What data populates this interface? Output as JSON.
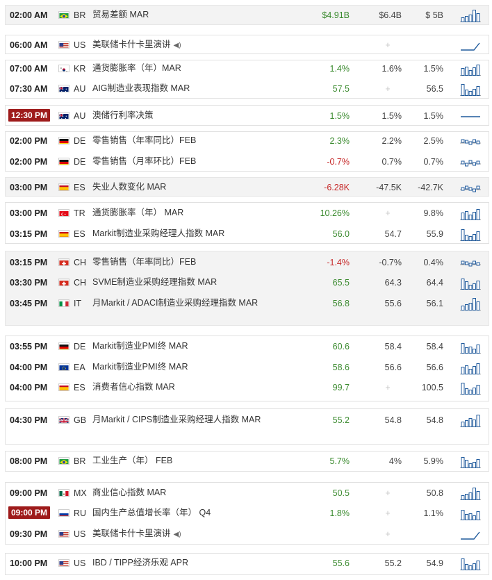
{
  "colors": {
    "positive": "#3a8a2e",
    "negative": "#c62828",
    "badge": "#9e1b1b",
    "chart": "#1f5a9c"
  },
  "events": [
    {
      "time": "02:00 AM",
      "badge": false,
      "flag": "br",
      "country": "BR",
      "event": "贸易差额 MAR",
      "actual": "$4.91B",
      "actual_class": "pos",
      "forecast": "$6.4B",
      "previous": "$ 5B",
      "chart": "bars"
    },
    {
      "time": "06:00 AM",
      "badge": false,
      "flag": "us",
      "country": "US",
      "event": "美联储卡什卡里演讲",
      "speaker": true,
      "actual": "",
      "forecast": "+",
      "previous": "",
      "chart": "speech"
    },
    {
      "time": "07:00 AM",
      "badge": false,
      "flag": "kr",
      "country": "KR",
      "event": "通货膨胀率（年）MAR",
      "actual": "1.4%",
      "actual_class": "pos",
      "forecast": "1.6%",
      "previous": "1.5%",
      "chart": "bars"
    },
    {
      "time": "07:30 AM",
      "badge": false,
      "flag": "au",
      "country": "AU",
      "event": "AIG制造业表现指数 MAR",
      "actual": "57.5",
      "actual_class": "pos",
      "forecast": "+",
      "previous": "56.5",
      "chart": "bars"
    },
    {
      "time": "12:30 PM",
      "badge": true,
      "flag": "au",
      "country": "AU",
      "event": "澳储行利率决策",
      "actual": "1.5%",
      "actual_class": "pos",
      "forecast": "1.5%",
      "previous": "1.5%",
      "chart": "flat"
    },
    {
      "time": "02:00 PM",
      "badge": false,
      "flag": "de",
      "country": "DE",
      "event": "零售销售（年率同比）FEB",
      "actual": "2.3%",
      "actual_class": "pos",
      "forecast": "2.2%",
      "previous": "2.5%",
      "chart": "step"
    },
    {
      "time": "02:00 PM",
      "badge": false,
      "flag": "de",
      "country": "DE",
      "event": "零售销售（月率环比）FEB",
      "actual": "-0.7%",
      "actual_class": "neg",
      "forecast": "0.7%",
      "previous": "0.7%",
      "chart": "step"
    },
    {
      "time": "03:00 PM",
      "badge": false,
      "flag": "es",
      "country": "ES",
      "event": "失业人数变化 MAR",
      "actual": "-6.28K",
      "actual_class": "neg",
      "forecast": "-47.5K",
      "previous": "-42.7K",
      "chart": "step"
    },
    {
      "time": "03:00 PM",
      "badge": false,
      "flag": "tr",
      "country": "TR",
      "event": "通货膨胀率（年） MAR",
      "actual": "10.26%",
      "actual_class": "pos",
      "forecast": "+",
      "previous": "9.8%",
      "chart": "bars"
    },
    {
      "time": "03:15 PM",
      "badge": false,
      "flag": "es",
      "country": "ES",
      "event": "Markit制造业采购经理人指数 MAR",
      "actual": "56.0",
      "actual_class": "pos",
      "forecast": "54.7",
      "previous": "55.9",
      "chart": "bars"
    },
    {
      "time": "03:15 PM",
      "badge": false,
      "flag": "ch",
      "country": "CH",
      "event": "零售销售（年率同比）FEB",
      "actual": "-1.4%",
      "actual_class": "neg",
      "forecast": "-0.7%",
      "previous": "0.4%",
      "chart": "step"
    },
    {
      "time": "03:30 PM",
      "badge": false,
      "flag": "ch",
      "country": "CH",
      "event": "SVME制造业采购经理指数 MAR",
      "actual": "65.5",
      "actual_class": "pos",
      "forecast": "64.3",
      "previous": "64.4",
      "chart": "bars"
    },
    {
      "time": "03:45 PM",
      "badge": false,
      "flag": "it",
      "country": "IT",
      "event": "月Markit / ADACI制造业采购经理指数 MAR",
      "actual": "56.8",
      "actual_class": "pos",
      "forecast": "55.6",
      "previous": "56.1",
      "chart": "bars"
    },
    {
      "time": "03:55 PM",
      "badge": false,
      "flag": "de",
      "country": "DE",
      "event": "Markit制造业PMI终 MAR",
      "actual": "60.6",
      "actual_class": "pos",
      "forecast": "58.4",
      "previous": "58.4",
      "chart": "bars"
    },
    {
      "time": "04:00 PM",
      "badge": false,
      "flag": "eu",
      "country": "EA",
      "event": "Markit制造业PMI终 MAR",
      "actual": "58.6",
      "actual_class": "pos",
      "forecast": "56.6",
      "previous": "56.6",
      "chart": "bars"
    },
    {
      "time": "04:00 PM",
      "badge": false,
      "flag": "es",
      "country": "ES",
      "event": "消费者信心指数 MAR",
      "actual": "99.7",
      "actual_class": "pos",
      "forecast": "+",
      "previous": "100.5",
      "chart": "bars"
    },
    {
      "time": "04:30 PM",
      "badge": false,
      "flag": "gb",
      "country": "GB",
      "event": "月Markit / CIPS制造业采购经理人指数 MAR",
      "actual": "55.2",
      "actual_class": "pos",
      "forecast": "54.8",
      "previous": "54.8",
      "chart": "bars"
    },
    {
      "time": "08:00 PM",
      "badge": false,
      "flag": "br",
      "country": "BR",
      "event": "工业生产（年） FEB",
      "actual": "5.7%",
      "actual_class": "pos",
      "forecast": "4%",
      "previous": "5.9%",
      "chart": "bars"
    },
    {
      "time": "09:00 PM",
      "badge": false,
      "flag": "mx",
      "country": "MX",
      "event": "商业信心指数 MAR",
      "actual": "50.5",
      "actual_class": "pos",
      "forecast": "+",
      "previous": "50.8",
      "chart": "bars"
    },
    {
      "time": "09:00 PM",
      "badge": true,
      "flag": "ru",
      "country": "RU",
      "event": "国内生产总值增长率（年） Q4",
      "actual": "1.8%",
      "actual_class": "pos",
      "forecast": "+",
      "previous": "1.1%",
      "chart": "bars"
    },
    {
      "time": "09:30 PM",
      "badge": false,
      "flag": "us",
      "country": "US",
      "event": "美联储卡什卡里演讲",
      "speaker": true,
      "actual": "",
      "forecast": "+",
      "previous": "",
      "chart": "speech"
    },
    {
      "time": "10:00 PM",
      "badge": false,
      "flag": "us",
      "country": "US",
      "event": "IBD / TIPP经济乐观 APR",
      "actual": "55.6",
      "actual_class": "pos",
      "forecast": "55.2",
      "previous": "54.9",
      "chart": "bars"
    }
  ]
}
